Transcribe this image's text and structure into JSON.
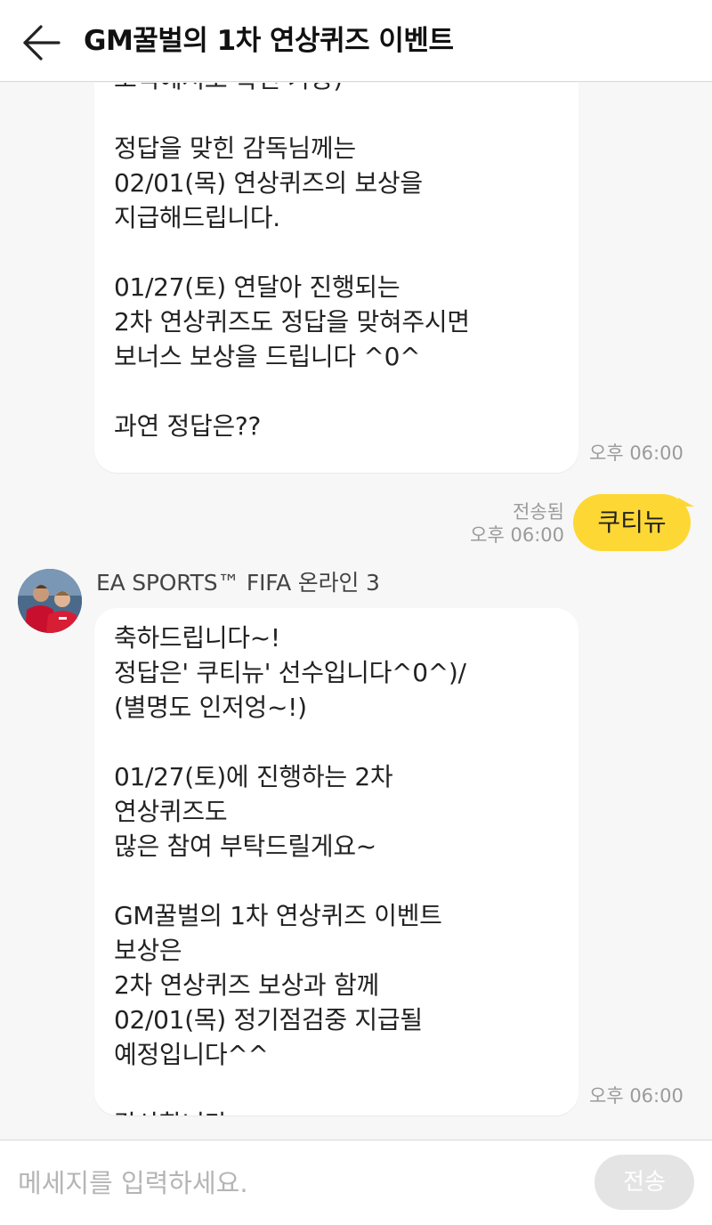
{
  "header": {
    "title": "GM꿀벌의 1차 연상퀴즈 이벤트",
    "back_icon": "arrow-left-icon"
  },
  "messages": [
    {
      "from": "other",
      "text": "소식에서도 확인 가능)\n\n정답을 맞힌 감독님께는\n02/01(목) 연상퀴즈의 보상을\n지급해드립니다.\n\n01/27(토) 연달아 진행되는\n2차 연상퀴즈도 정답을 맞혀주시면\n보너스 보상을 드립니다 ^0^\n\n과연 정답은??",
      "time": "오후 06:00"
    },
    {
      "from": "me",
      "text": "쿠티뉴",
      "status": "전송됨",
      "time": "오후 06:00"
    },
    {
      "from": "other",
      "sender": "EA SPORTS™ FIFA 온라인 3",
      "avatar": "soccer-players-avatar",
      "text": "축하드립니다~!\n정답은' 쿠티뉴' 선수입니다^0^)/\n(별명도 인저엉~!)\n\n01/27(토)에 진행하는 2차\n연상퀴즈도\n많은 참여 부탁드릴게요~\n\nGM꿀벌의 1차 연상퀴즈 이벤트\n보상은\n2차 연상퀴즈 보상과 함께\n02/01(목) 정기점검중 지급될\n예정입니다^^\n\n감사합니다.",
      "time": "오후 06:00"
    }
  ],
  "input": {
    "placeholder": "메세지를 입력하세요.",
    "value": "",
    "send_label": "전송"
  },
  "colors": {
    "my_bubble": "#fdd835",
    "background": "#f7f7f7",
    "send_button": "#e4e4e4"
  }
}
